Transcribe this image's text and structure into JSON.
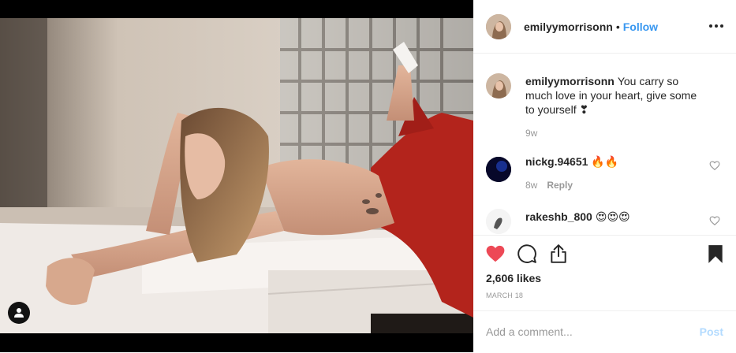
{
  "post": {
    "username": "emilyymorrisonn",
    "follow_label": "Follow",
    "separator": "•"
  },
  "caption": {
    "username": "emilyymorrisonn",
    "text": "You carry so much love in your heart, give some to yourself ❣",
    "time": "9w"
  },
  "comments": [
    {
      "username": "nickg.94651",
      "text": "🔥🔥",
      "time": "8w",
      "reply_label": "Reply"
    },
    {
      "username": "rakeshb_800",
      "text": "😍😍😍"
    }
  ],
  "stats": {
    "likes": "2,606 likes",
    "date": "March 18"
  },
  "add_comment": {
    "placeholder": "Add a comment...",
    "post_label": "Post"
  },
  "colors": {
    "accent": "#3897f0",
    "liked_heart": "#ed4956",
    "post_disabled": "#b3dbff"
  },
  "icons": [
    "user-tag-icon",
    "more-options-icon",
    "heart-icon",
    "comment-icon",
    "share-icon",
    "bookmark-icon"
  ]
}
